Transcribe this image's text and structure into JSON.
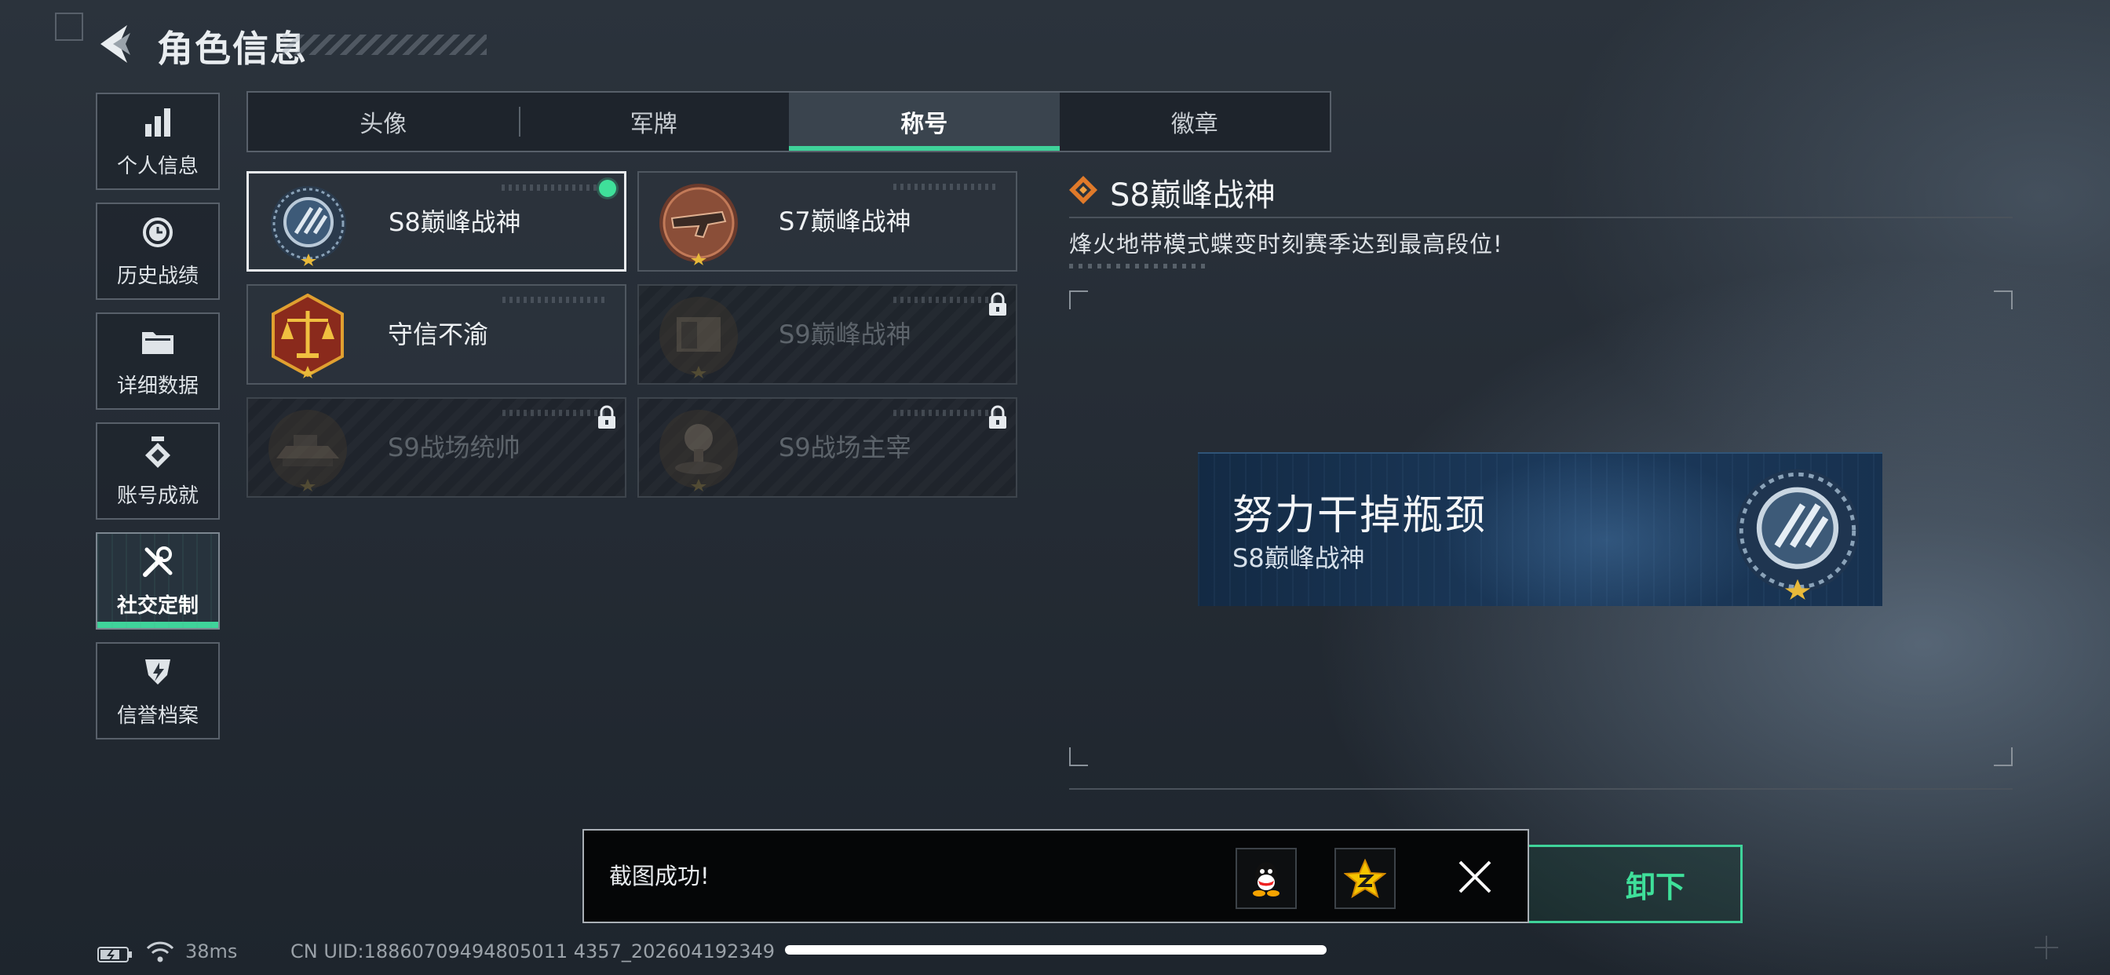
{
  "header": {
    "title": "角色信息"
  },
  "sidebar": {
    "items": [
      {
        "label": "个人信息",
        "icon": "bar-chart-icon"
      },
      {
        "label": "历史战绩",
        "icon": "history-clock-icon"
      },
      {
        "label": "详细数据",
        "icon": "folder-icon"
      },
      {
        "label": "账号成就",
        "icon": "achievement-icon"
      },
      {
        "label": "社交定制",
        "icon": "tools-icon",
        "active": true
      },
      {
        "label": "信誉档案",
        "icon": "credit-shield-icon"
      }
    ]
  },
  "tabs": [
    {
      "label": "头像"
    },
    {
      "label": "军牌"
    },
    {
      "label": "称号",
      "active": true
    },
    {
      "label": "徽章"
    }
  ],
  "titles": [
    {
      "name": "S8巅峰战神",
      "selected": true,
      "locked": false
    },
    {
      "name": "S7巅峰战神",
      "selected": false,
      "locked": false
    },
    {
      "name": "守信不渝",
      "selected": false,
      "locked": false
    },
    {
      "name": "S9巅峰战神",
      "selected": false,
      "locked": true
    },
    {
      "name": "S9战场统帅",
      "selected": false,
      "locked": true
    },
    {
      "name": "S9战场主宰",
      "selected": false,
      "locked": true
    }
  ],
  "detail": {
    "title": "S8巅峰战神",
    "description": "烽火地带模式蝶变时刻赛季达到最高段位!"
  },
  "nameplate": {
    "player_name": "努力干掉瓶颈",
    "title": "S8巅峰战神"
  },
  "equip_button": {
    "label": "卸下",
    "visible_fragment": "卸下"
  },
  "toast": {
    "message": "截图成功!",
    "share_targets": [
      "qq-icon",
      "qzone-icon"
    ]
  },
  "status": {
    "ping": "38ms",
    "uid": "CN UID:18860709494805011 4357_202604192349"
  },
  "colors": {
    "accent": "#3fd39a",
    "panel_border": "#58606a",
    "plate_blue": "#1c3a5c"
  }
}
